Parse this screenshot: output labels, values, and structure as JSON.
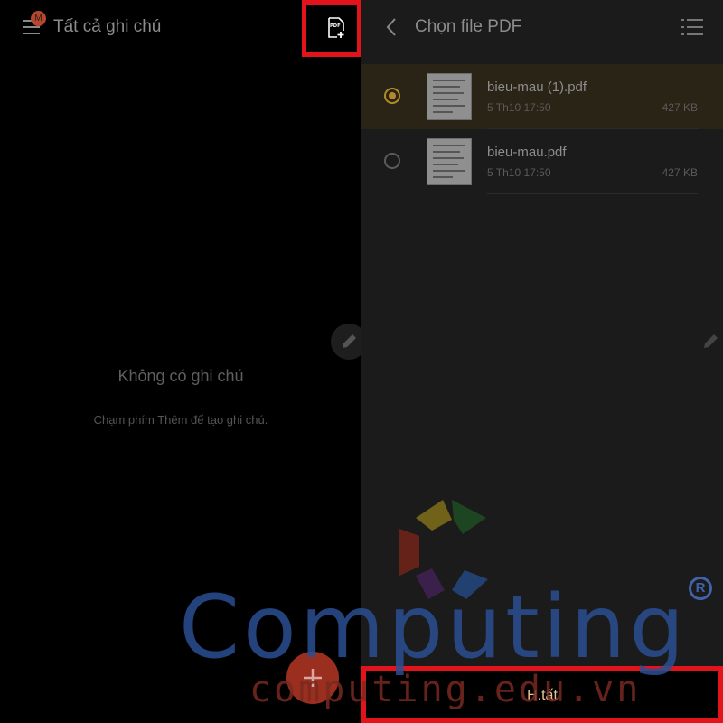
{
  "left_panel": {
    "title": "Tất cả ghi chú",
    "avatar_initial": "M",
    "pdf_icon_text": "PDF",
    "empty_title": "Không có ghi chú",
    "empty_hint": "Chạm phím Thêm để tạo ghi chú.",
    "icons": {
      "menu": "menu-icon",
      "pdf_add": "pdf-add-icon",
      "edit": "pencil-icon",
      "add": "plus-icon"
    }
  },
  "right_panel": {
    "title": "Chọn file PDF",
    "files": [
      {
        "name": "bieu-mau (1).pdf",
        "date": "5 Th10 17:50",
        "size": "427 KB",
        "selected": true
      },
      {
        "name": "bieu-mau.pdf",
        "date": "5 Th10 17:50",
        "size": "427 KB",
        "selected": false
      }
    ],
    "done_label": "H.tất",
    "icons": {
      "back": "chevron-left-icon",
      "view": "list-view-icon"
    }
  },
  "watermark": {
    "brand": "Computing",
    "registered": "R",
    "url": "computing.edu.vn"
  },
  "colors": {
    "highlight_red": "#e3131b",
    "selected_radio": "#b38a2a",
    "fab_red": "#9b2f1f"
  }
}
